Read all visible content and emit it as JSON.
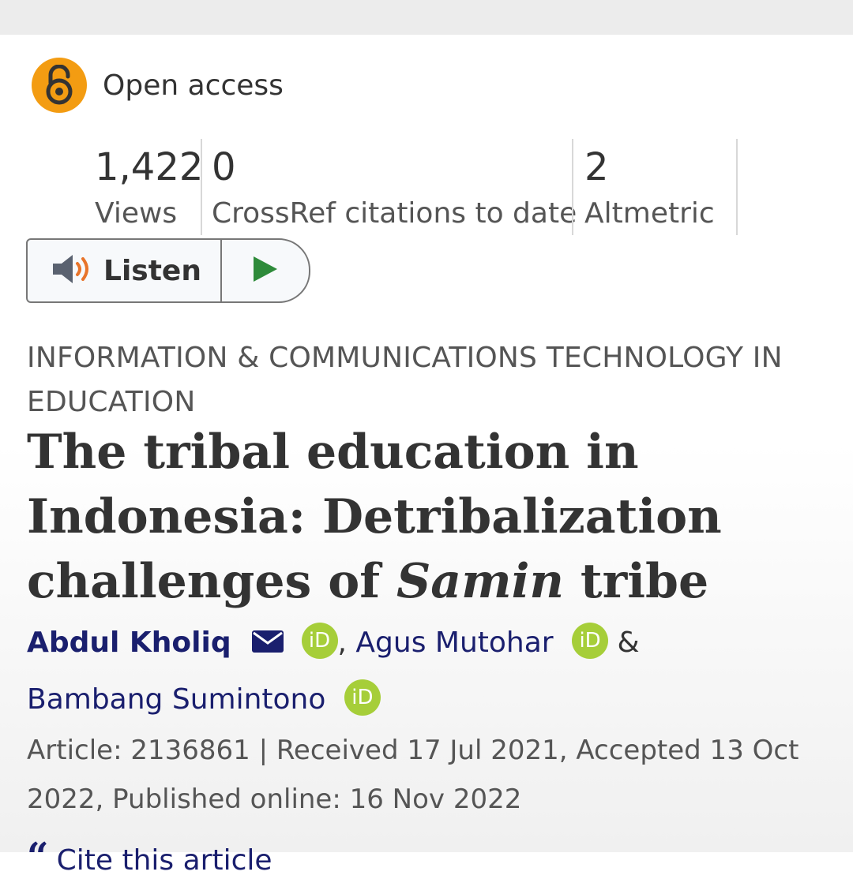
{
  "access": {
    "label": "Open access",
    "icon": "open-lock-icon",
    "color": "#f39c12"
  },
  "metrics": [
    {
      "value": "1,422",
      "label": "Views"
    },
    {
      "value": "0",
      "label": "CrossRef citations to date"
    },
    {
      "value": "2",
      "label": "Altmetric"
    }
  ],
  "listen": {
    "label": "Listen",
    "speaker_icon": "speaker-icon",
    "play_icon": "play-icon",
    "play_color": "#2e8b3a"
  },
  "article": {
    "subject": "INFORMATION & COMMUNICATIONS TECHNOLOGY IN EDUCATION",
    "title_part1": "The tribal education in Indonesia: Detribalization challenges of ",
    "title_italic": "Samin",
    "title_part2": " tribe",
    "authors": [
      {
        "name": "Abdul Kholiq",
        "email_icon": "envelope-icon",
        "orcid": "iD"
      },
      {
        "name": "Agus Mutohar",
        "orcid": "iD"
      },
      {
        "name": "Bambang Sumintono",
        "orcid": "iD"
      }
    ],
    "sep_comma": ",",
    "sep_amp": "&",
    "meta": "Article: 2136861 | Received 17 Jul 2021, Accepted 13 Oct 2022, Published online: 16 Nov 2022",
    "cite_icon": "quote-icon",
    "cite_label": "Cite this article"
  },
  "colors": {
    "author_link": "#1a1f6e",
    "orcid": "#a6ce39",
    "text": "#333333"
  }
}
